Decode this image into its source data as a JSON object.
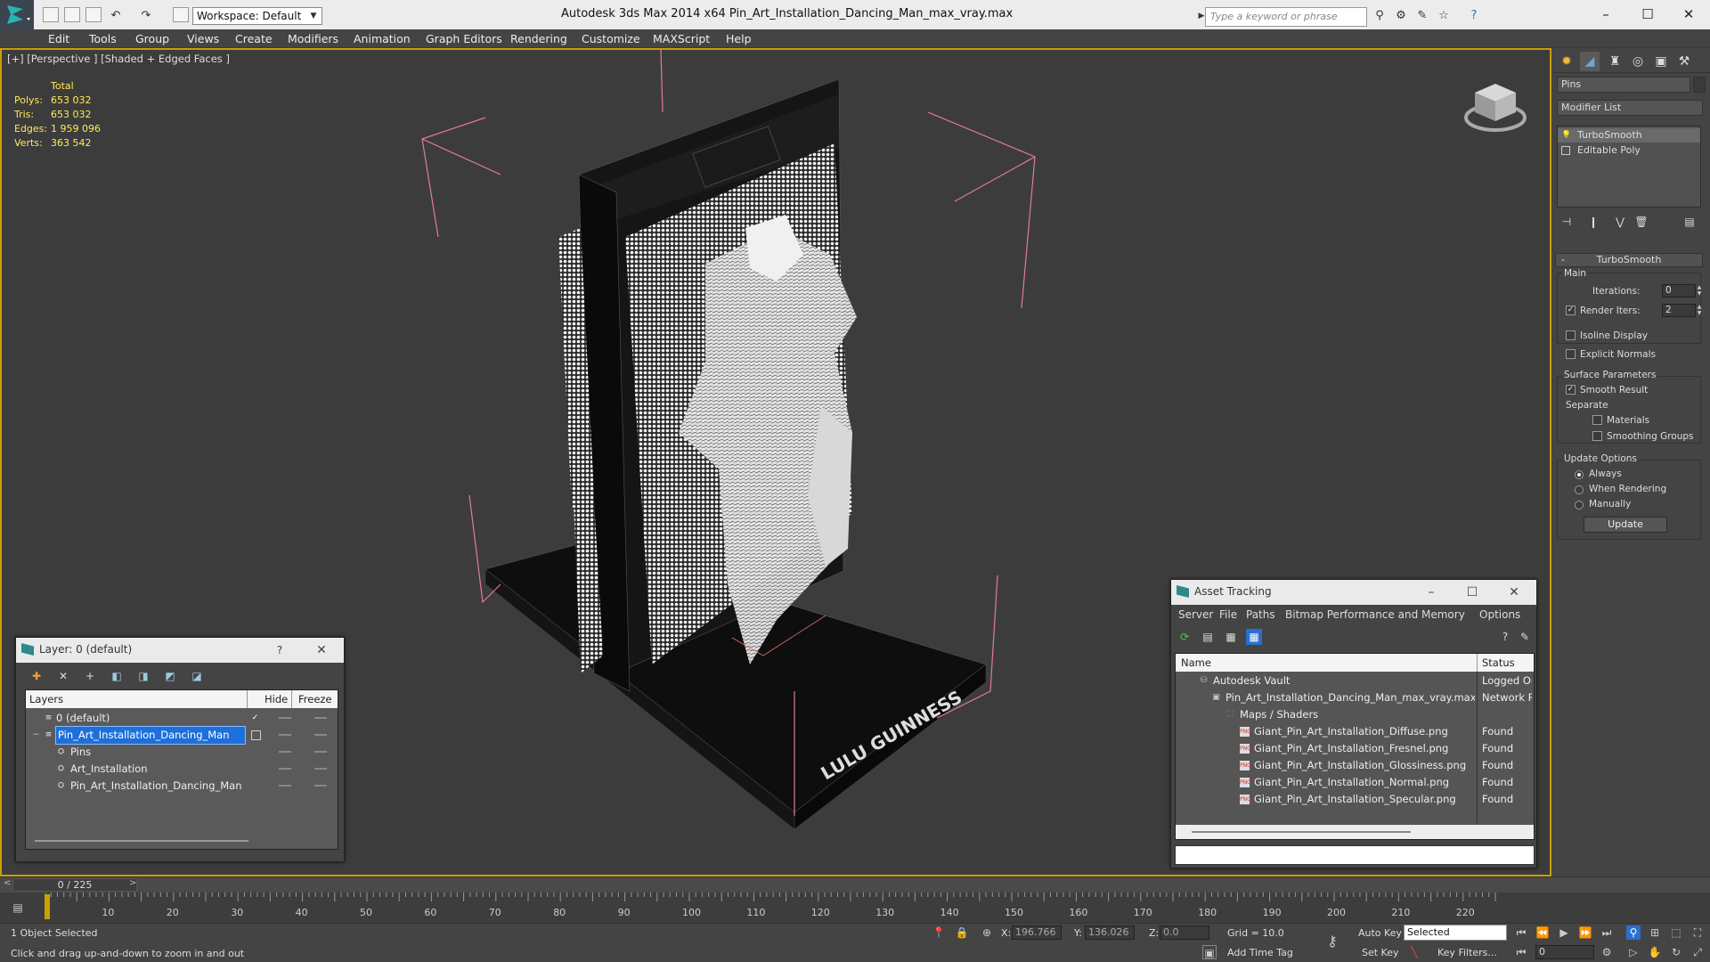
{
  "app": {
    "title": "Autodesk 3ds Max  2014 x64      Pin_Art_Installation_Dancing_Man_max_vray.max",
    "workspace": "Workspace: Default",
    "search_placeholder": "Type a keyword or phrase"
  },
  "menu": [
    "Edit",
    "Tools",
    "Group",
    "Views",
    "Create",
    "Modifiers",
    "Animation",
    "Graph Editors",
    "Rendering",
    "Customize",
    "MAXScript",
    "Help"
  ],
  "viewport": {
    "label": "[+] [Perspective ] [Shaded + Edged Faces ]",
    "stats": {
      "header": "Total",
      "rows": [
        {
          "key": "Polys:",
          "value": "653 032"
        },
        {
          "key": "Tris:",
          "value": "653 032"
        },
        {
          "key": "Edges:",
          "value": "1 959 096"
        },
        {
          "key": "Verts:",
          "value": "363 542"
        }
      ]
    },
    "base_text": "LULU GUINNESS"
  },
  "command_panel": {
    "object_name": "Pins",
    "modifier_list": "Modifier List",
    "stack": [
      "TurboSmooth",
      "Editable Poly"
    ],
    "rollout_title": "TurboSmooth",
    "main_label": "Main",
    "iterations_label": "Iterations:",
    "iterations_value": "0",
    "render_iters_label": "Render Iters:",
    "render_iters_value": "2",
    "isoline": "Isoline Display",
    "explicit_normals": "Explicit Normals",
    "surface_params": "Surface Parameters",
    "smooth_result": "Smooth Result",
    "separate": "Separate",
    "materials": "Materials",
    "smoothing_groups": "Smoothing Groups",
    "update_options": "Update Options",
    "always": "Always",
    "when_rendering": "When Rendering",
    "manually": "Manually",
    "update_button": "Update"
  },
  "layer_dialog": {
    "title": "Layer: 0 (default)",
    "columns": [
      "Layers",
      "Hide",
      "Freeze"
    ],
    "rows": [
      {
        "name": "0 (default)",
        "indent": 0
      },
      {
        "name": "Pin_Art_Installation_Dancing_Man",
        "indent": 0
      },
      {
        "name": "Pins",
        "indent": 1
      },
      {
        "name": "Art_Installation",
        "indent": 1
      },
      {
        "name": "Pin_Art_Installation_Dancing_Man",
        "indent": 1
      }
    ]
  },
  "asset_dialog": {
    "title": "Asset Tracking",
    "menu": [
      "Server",
      "File",
      "Paths",
      "Bitmap Performance and Memory",
      "Options"
    ],
    "columns": [
      "Name",
      "Status"
    ],
    "rows": [
      {
        "name": "Autodesk Vault",
        "status": "Logged Ou",
        "indent": 0
      },
      {
        "name": "Pin_Art_Installation_Dancing_Man_max_vray.max",
        "status": "Network P",
        "indent": 1
      },
      {
        "name": "Maps / Shaders",
        "status": "",
        "indent": 2
      },
      {
        "name": "Giant_Pin_Art_Installation_Diffuse.png",
        "status": "Found",
        "indent": 3
      },
      {
        "name": "Giant_Pin_Art_Installation_Fresnel.png",
        "status": "Found",
        "indent": 3
      },
      {
        "name": "Giant_Pin_Art_Installation_Glossiness.png",
        "status": "Found",
        "indent": 3
      },
      {
        "name": "Giant_Pin_Art_Installation_Normal.png",
        "status": "Found",
        "indent": 3
      },
      {
        "name": "Giant_Pin_Art_Installation_Specular.png",
        "status": "Found",
        "indent": 3
      }
    ]
  },
  "timeline": {
    "frame_display": "0 / 225",
    "ticks": [
      "10",
      "20",
      "30",
      "40",
      "50",
      "60",
      "70",
      "80",
      "90",
      "100",
      "110",
      "120",
      "130",
      "140",
      "150",
      "160",
      "170",
      "180",
      "190",
      "200",
      "210",
      "220"
    ]
  },
  "status": {
    "selection": "1 Object Selected",
    "prompt": "Click and drag up-and-down to zoom in and out",
    "x_label": "X:",
    "x_value": "196.766",
    "y_label": "Y:",
    "y_value": "136.026",
    "z_label": "Z:",
    "z_value": "0.0",
    "grid": "Grid = 10.0",
    "auto_key": "Auto Key",
    "set_key": "Set Key",
    "selected": "Selected",
    "key_filters": "Key Filters...",
    "add_time_tag": "Add Time Tag",
    "frame": "0"
  }
}
